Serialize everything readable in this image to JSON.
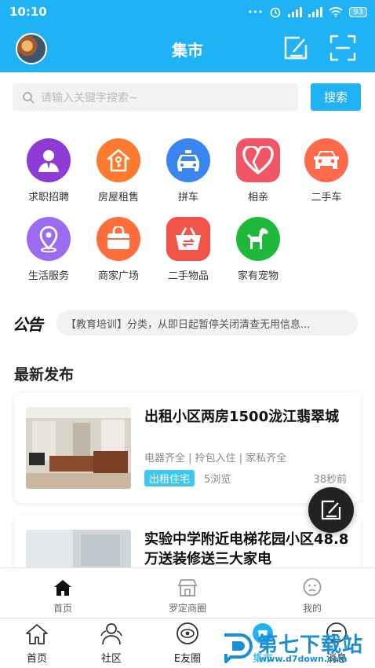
{
  "status": {
    "time": "10:10",
    "dots": "•••",
    "battery": "93"
  },
  "header": {
    "title": "集市",
    "brand_color": "#1fb3f5"
  },
  "search": {
    "placeholder": "请输入关键字搜索~",
    "button": "搜索"
  },
  "categories": [
    {
      "label": "求职招聘",
      "color": "#8e3bd6",
      "icon": "person-icon"
    },
    {
      "label": "房屋租售",
      "color": "#ff7a2e",
      "icon": "house-key-icon"
    },
    {
      "label": "拼车",
      "color": "#3a86f0",
      "icon": "car-icon"
    },
    {
      "label": "相亲",
      "color": "#f05666",
      "icon": "heart-icon"
    },
    {
      "label": "二手车",
      "color": "#ff6b4a",
      "icon": "car-front-icon"
    },
    {
      "label": "生活服务",
      "color": "#9b6bf0",
      "icon": "location-pin-icon"
    },
    {
      "label": "商家广场",
      "color": "#ff6d3a",
      "icon": "shopping-bag-icon"
    },
    {
      "label": "二手物品",
      "color": "#f2544a",
      "icon": "basket-icon"
    },
    {
      "label": "家有宠物",
      "color": "#1eb83a",
      "icon": "dog-icon"
    }
  ],
  "notice": {
    "logo": "公告",
    "text": "【教育培训】分类，从即日起暂停关闭清查无用信息..."
  },
  "latest": {
    "title": "最新发布",
    "posts": [
      {
        "title": "出租小区两房1500泷江翡翠城",
        "tags": "电器齐全  |  拎包入住  |  家私齐全",
        "badge": "出租住宅",
        "views": "5浏览",
        "ago": "38秒前"
      },
      {
        "title": "实验中学附近电梯花园小区48.8万送装修送三大家电"
      }
    ]
  },
  "tabbar_inner": [
    {
      "label": "首页",
      "icon": "home-icon",
      "active": true
    },
    {
      "label": "罗定商圈",
      "icon": "store-icon"
    },
    {
      "label": "我的",
      "icon": "face-icon"
    }
  ],
  "tabbar_outer": [
    {
      "label": "首页",
      "icon": "home-outline-icon"
    },
    {
      "label": "社区",
      "icon": "community-icon"
    },
    {
      "label": "E友圈",
      "icon": "eye-circle-icon"
    },
    {
      "label": "集市",
      "icon": "market-icon"
    },
    {
      "label": "消息",
      "icon": "message-icon"
    }
  ],
  "watermark": {
    "text": "第七下载站",
    "url": "www.d7down.com"
  }
}
